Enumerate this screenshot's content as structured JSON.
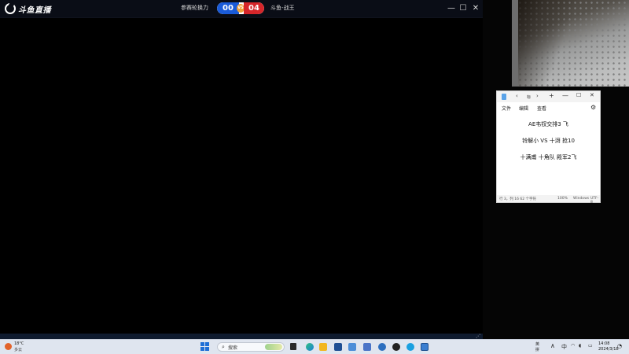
{
  "game_window": {
    "logo_text": "斗鱼直播",
    "stream_title": "参赛轮换力",
    "score": {
      "left": "00",
      "right": "04",
      "vs": "VS"
    },
    "match_title": "斗鱼-战王",
    "controls": {
      "minimize": "—",
      "maximize": "☐",
      "close": "✕"
    },
    "resize_grip": "⋰"
  },
  "notepad": {
    "tab": {
      "prev": "‹",
      "title": "标",
      "next": "›",
      "add": "+"
    },
    "controls": {
      "minimize": "—",
      "maximize": "☐",
      "close": "✕"
    },
    "menu": {
      "file": "文件",
      "edit": "编辑",
      "view": "查看"
    },
    "settings_icon": "⚙",
    "lines": [
      "AE韦钗交排3 飞",
      "铃解小 VS 十湃 抢10",
      "十满甫 十角队 殿军2飞"
    ],
    "status": {
      "position": "行 3，列 16   62 个字符",
      "zoom": "100%",
      "eol": "Windows",
      "encoding": "UTF-8"
    }
  },
  "taskbar": {
    "weather": {
      "temp": "18°C",
      "desc": "多云"
    },
    "search_placeholder": "搜索",
    "search_icon": "⌕",
    "tray": {
      "text1": "英",
      "text2": "拼",
      "chevron": "∧",
      "ime": "中",
      "net": "◠",
      "vol": "◖",
      "batt": "▭",
      "time": "14:08",
      "date": "2024/3/18",
      "notify": "◔"
    }
  },
  "colors": {
    "score_blue": "#1a5bd8",
    "score_red": "#d6262a",
    "taskbar_bg": "#dfe5ef"
  }
}
